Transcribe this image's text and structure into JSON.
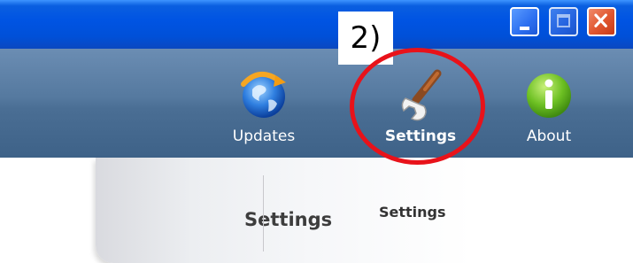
{
  "annotation": {
    "step": "2)"
  },
  "window": {
    "buttons": {
      "minimize": "minimize",
      "maximize": "maximize",
      "close": "close"
    }
  },
  "toolbar": {
    "items": [
      {
        "label": "Updates",
        "icon": "globe-update-icon"
      },
      {
        "label": "Settings",
        "icon": "wrench-icon",
        "highlighted": true
      },
      {
        "label": "About",
        "icon": "info-icon"
      }
    ]
  },
  "settings_panel": {
    "title": "Settings",
    "subtitle": "Settings"
  },
  "colors": {
    "titlebar": "#0054e3",
    "toolbar": "#55799f",
    "highlight": "#e8121a"
  }
}
